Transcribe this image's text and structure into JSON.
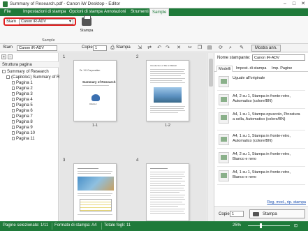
{
  "window": {
    "title": "Summary of Research.pdf - Canon iW Desktop - Editor",
    "minimize": "–",
    "maximize": "□",
    "close": "✕"
  },
  "ribbon_tabs": [
    "File",
    "Impostazioni di stampa",
    "Opzioni di stampa",
    "Annotazioni",
    "Strumenti",
    "Sample"
  ],
  "ribbon": {
    "printer_label": "Stam",
    "printer_value": "Canon iR-ADV",
    "print_label": "Stampa",
    "group_label": "Sample"
  },
  "toolbar": {
    "size_label": "Stam",
    "printer_value": "Canon iR-ADV",
    "copies_label": "Copie",
    "copies_value": "1",
    "print_label": "Stampa",
    "show_ann_label": "Mostra ann."
  },
  "tree": {
    "header": "Struttura pagina",
    "root": "Summary of Research",
    "chapter": "(Capitolo1) Summary of R",
    "pages": [
      "Pagina 1",
      "Pagina 2",
      "Pagina 3",
      "Pagina 4",
      "Pagina 5",
      "Pagina 6",
      "Pagina 7",
      "Pagina 8",
      "Pagina 9",
      "Pagina 10",
      "Pagina 11"
    ]
  },
  "preview": {
    "blocks": [
      {
        "num": "1",
        "label": "1-1",
        "heading": "Dr. XX Corporation",
        "title": "Summary of Research",
        "org": "DIEGHI"
      },
      {
        "num": "2",
        "label": "1-2",
        "heading": "Introduction of DE & DIEGHI"
      },
      {
        "num": "3",
        "label": ""
      },
      {
        "num": "4",
        "label": ""
      }
    ]
  },
  "right_panel": {
    "printer_label": "Nome stampante:",
    "printer_value": "Canon iR-ADV",
    "tabs": [
      "Modelli",
      "Impost. di stampa",
      "Imp. Pagine"
    ],
    "models": [
      "Uguale all'originale",
      "A4, 2 su 1, Stampa in fronte-retro, Automatico (colore/BN)",
      "A4, 1 su 1, Stampa opuscolo, Pinzatura a sella, Automatico (colore/BN)",
      "A4, 1 su 1, Stampa in fronte-retro, Automatico (colore/BN)",
      "A4, 2 su 1, Stampa in fronte-retro, Bianco e nero",
      "A4, 1 su 1, Stampa in fronte-retro, Bianco e nero"
    ],
    "link": "Reg. mod., rip. stampa",
    "copies_label": "Copie",
    "copies_value": "1",
    "print_button": "Stampa"
  },
  "status": {
    "selected": "Pagine selezionate: 1/11",
    "format": "Formato di stampa: A4",
    "sheets": "Totale fogli: 11",
    "zoom": "25%"
  },
  "colors": {
    "accent": "#1f7a3a",
    "highlight": "#e02020"
  }
}
